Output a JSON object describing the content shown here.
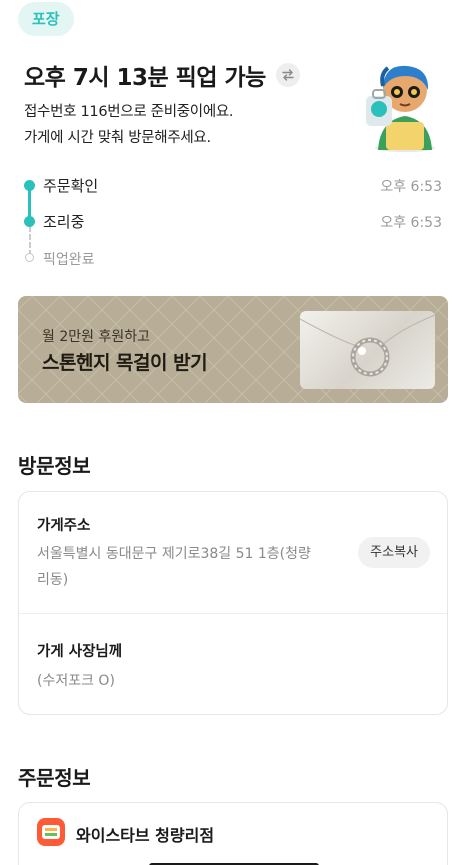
{
  "badge": "포장",
  "pickup": {
    "title": "오후 7시 13분 픽업 가능",
    "line1": "접수번호 116번으로 준비중이에요.",
    "line2": "가게에 시간 맞춰 방문해주세요."
  },
  "timeline": [
    {
      "label": "주문확인",
      "time": "오후 6:53",
      "done": true
    },
    {
      "label": "조리중",
      "time": "오후 6:53",
      "done": true
    },
    {
      "label": "픽업완료",
      "time": "",
      "done": false
    }
  ],
  "banner": {
    "sub": "월 2만원 후원하고",
    "main": "스톤헨지 목걸이 받기"
  },
  "visit_section": {
    "title": "방문정보",
    "address_label": "가게주소",
    "address_line1": "서울특별시 동대문구 제기로38길 51 1층(청량",
    "address_line2": "리동)",
    "copy_button": "주소복사",
    "owner_label": "가게 사장님께",
    "owner_note": "(수저포크 O)"
  },
  "order_section": {
    "title": "주문정보",
    "store_name": "와이스타브 청량리점"
  },
  "colors": {
    "accent": "#2ac1bc",
    "banner": "#b8ae97",
    "store_icon": "#ff5a36"
  }
}
